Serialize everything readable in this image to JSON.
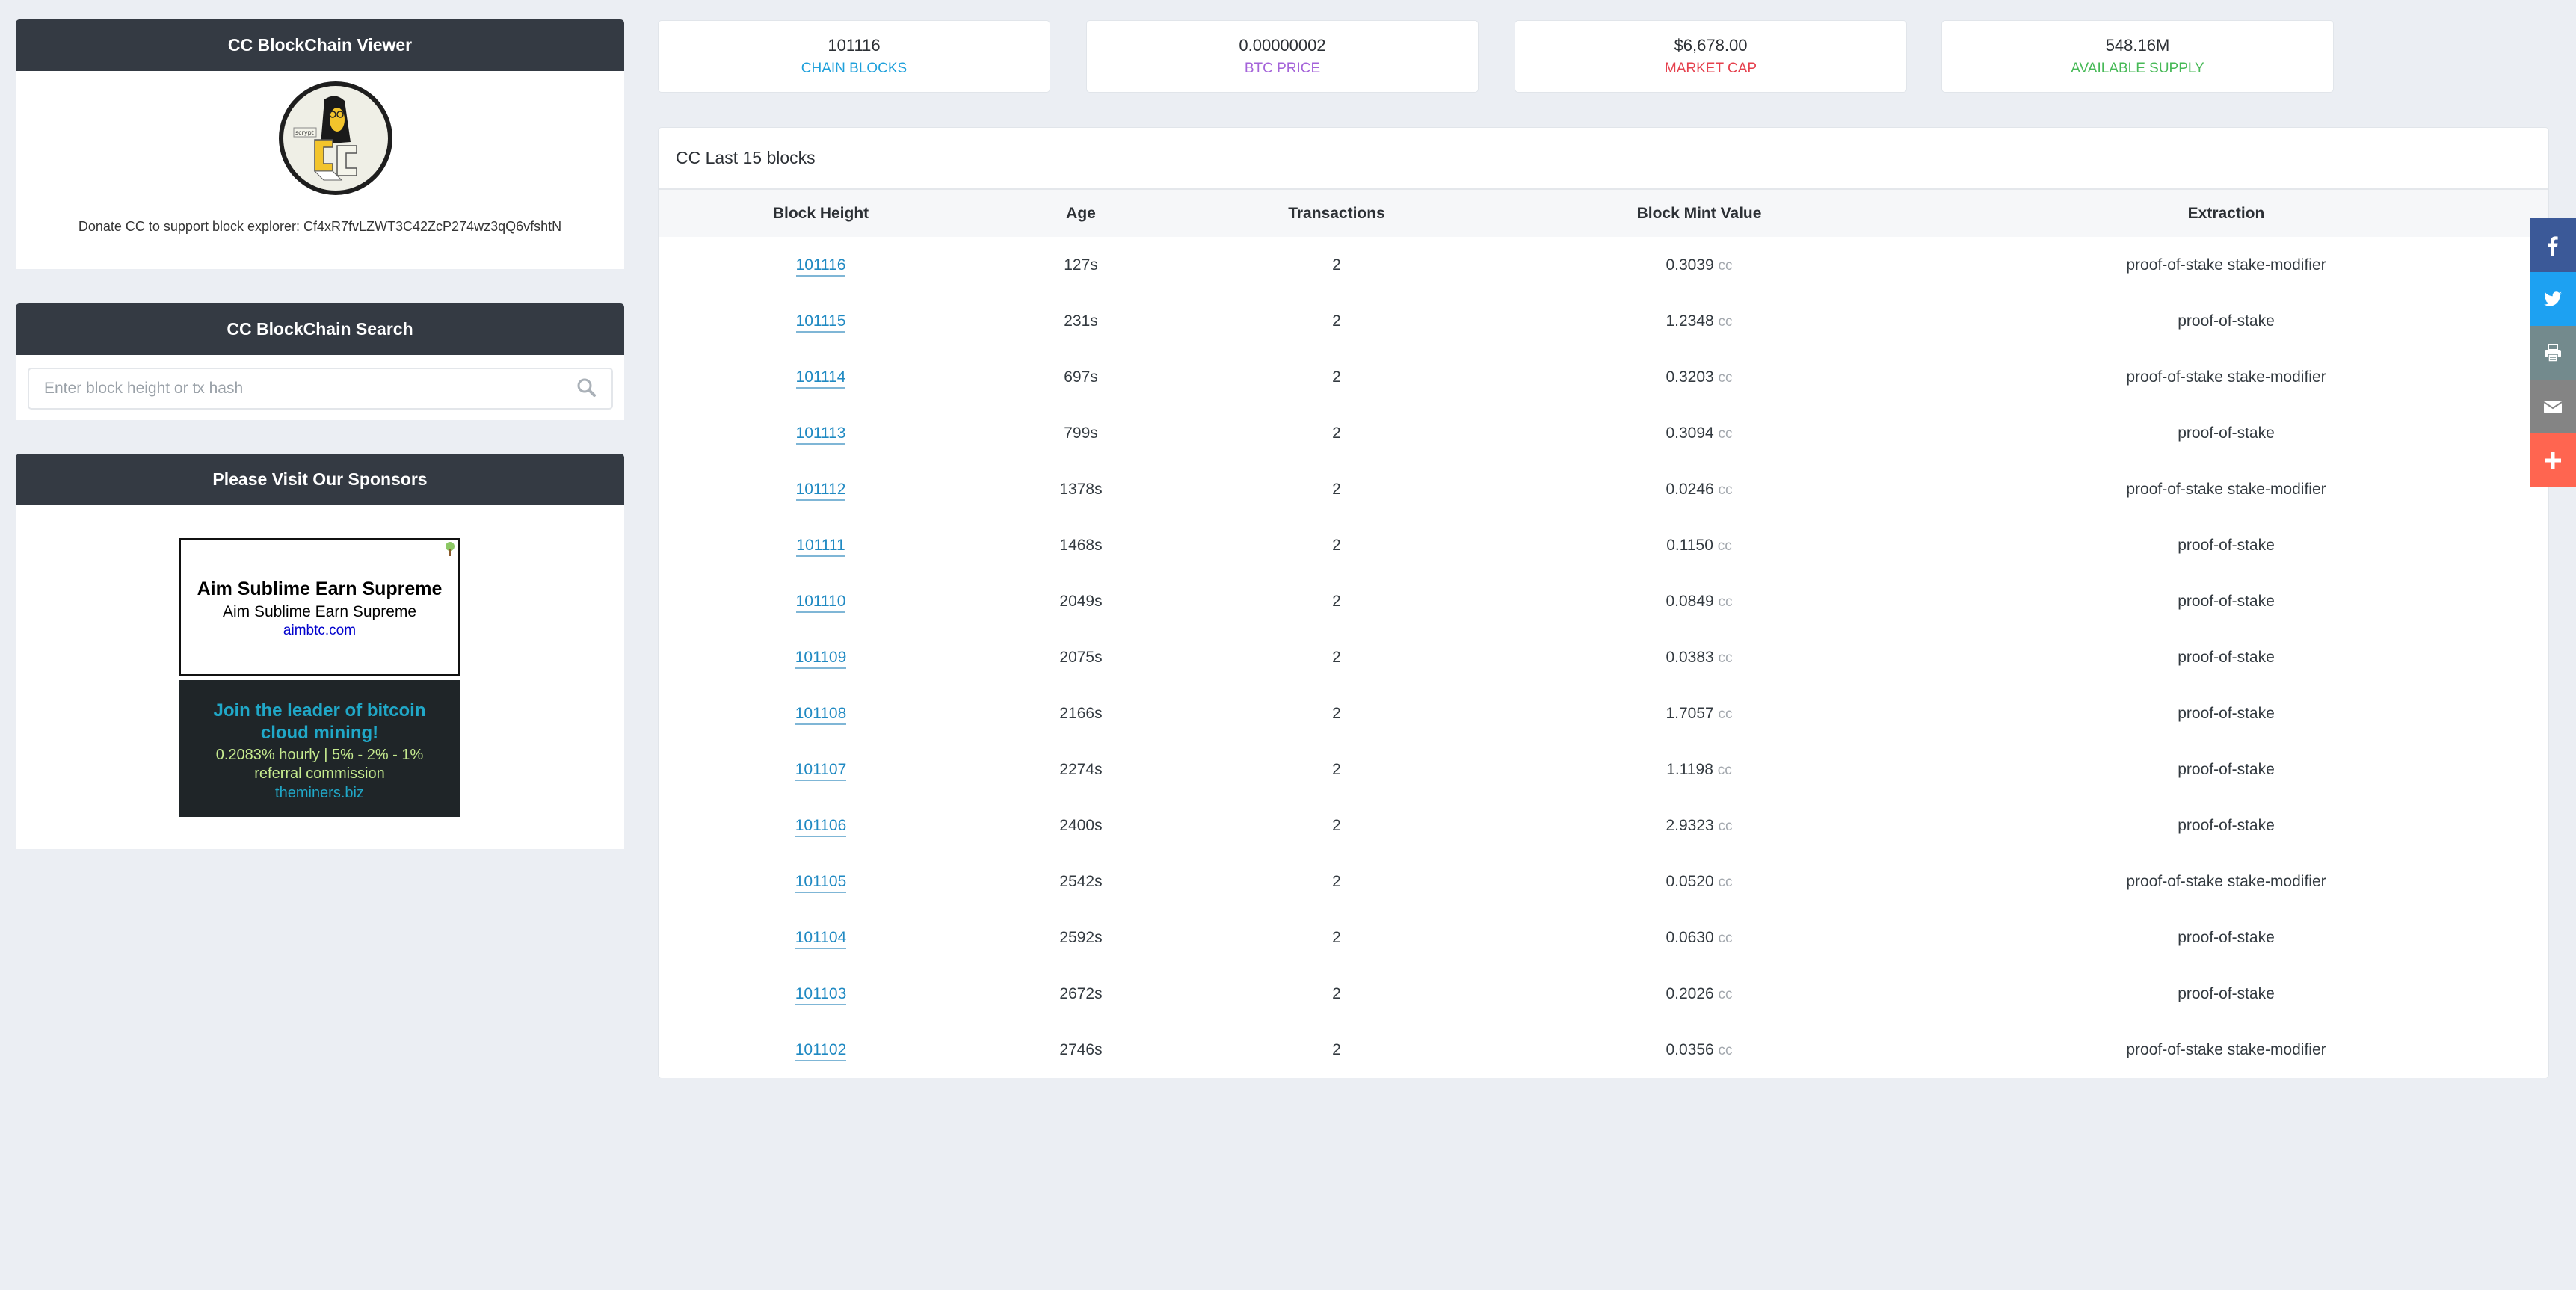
{
  "sidebar": {
    "viewer": {
      "title": "CC BlockChain Viewer",
      "logo_text": "scrypt",
      "donate_text": "Donate CC to support block explorer: Cf4xR7fvLZWT3C42ZcP274wz3qQ6vfshtN"
    },
    "search": {
      "title": "CC BlockChain Search",
      "placeholder": "Enter block height or tx hash",
      "value": "",
      "icon": "search-icon"
    },
    "sponsors": {
      "title": "Please Visit Our Sponsors",
      "ads": [
        {
          "headline": "Aim Sublime Earn Supreme",
          "subline": "Aim Sublime Earn Supreme",
          "url": "aimbtc.com"
        },
        {
          "headline": "Join the leader of bitcoin cloud mining!",
          "subline": "0.2083% hourly | 5% - 2% - 1% referral commission",
          "url": "theminers.biz"
        }
      ]
    }
  },
  "stats": [
    {
      "value": "101116",
      "label": "CHAIN BLOCKS",
      "color": "#1ea0db"
    },
    {
      "value": "0.00000002",
      "label": "BTC PRICE",
      "color": "#a463d9"
    },
    {
      "value": "$6,678.00",
      "label": "MARKET CAP",
      "color": "#e5404d"
    },
    {
      "value": "548.16M",
      "label": "AVAILABLE SUPPLY",
      "color": "#47b957"
    }
  ],
  "blocks": {
    "title": "CC Last 15 blocks",
    "columns": [
      "Block Height",
      "Age",
      "Transactions",
      "Block Mint Value",
      "Extraction"
    ],
    "unit": "cc",
    "rows": [
      {
        "height": "101116",
        "age": "127s",
        "tx": "2",
        "mint": "0.3039",
        "extraction": "proof-of-stake stake-modifier"
      },
      {
        "height": "101115",
        "age": "231s",
        "tx": "2",
        "mint": "1.2348",
        "extraction": "proof-of-stake"
      },
      {
        "height": "101114",
        "age": "697s",
        "tx": "2",
        "mint": "0.3203",
        "extraction": "proof-of-stake stake-modifier"
      },
      {
        "height": "101113",
        "age": "799s",
        "tx": "2",
        "mint": "0.3094",
        "extraction": "proof-of-stake"
      },
      {
        "height": "101112",
        "age": "1378s",
        "tx": "2",
        "mint": "0.0246",
        "extraction": "proof-of-stake stake-modifier"
      },
      {
        "height": "101111",
        "age": "1468s",
        "tx": "2",
        "mint": "0.1150",
        "extraction": "proof-of-stake"
      },
      {
        "height": "101110",
        "age": "2049s",
        "tx": "2",
        "mint": "0.0849",
        "extraction": "proof-of-stake"
      },
      {
        "height": "101109",
        "age": "2075s",
        "tx": "2",
        "mint": "0.0383",
        "extraction": "proof-of-stake"
      },
      {
        "height": "101108",
        "age": "2166s",
        "tx": "2",
        "mint": "1.7057",
        "extraction": "proof-of-stake"
      },
      {
        "height": "101107",
        "age": "2274s",
        "tx": "2",
        "mint": "1.1198",
        "extraction": "proof-of-stake"
      },
      {
        "height": "101106",
        "age": "2400s",
        "tx": "2",
        "mint": "2.9323",
        "extraction": "proof-of-stake"
      },
      {
        "height": "101105",
        "age": "2542s",
        "tx": "2",
        "mint": "0.0520",
        "extraction": "proof-of-stake stake-modifier"
      },
      {
        "height": "101104",
        "age": "2592s",
        "tx": "2",
        "mint": "0.0630",
        "extraction": "proof-of-stake"
      },
      {
        "height": "101103",
        "age": "2672s",
        "tx": "2",
        "mint": "0.2026",
        "extraction": "proof-of-stake"
      },
      {
        "height": "101102",
        "age": "2746s",
        "tx": "2",
        "mint": "0.0356",
        "extraction": "proof-of-stake stake-modifier"
      }
    ]
  },
  "share": [
    {
      "name": "facebook",
      "icon": "facebook-icon",
      "color": "#3b5998"
    },
    {
      "name": "twitter",
      "icon": "twitter-icon",
      "color": "#1da1f2"
    },
    {
      "name": "print",
      "icon": "print-icon",
      "color": "#738a8d"
    },
    {
      "name": "email",
      "icon": "email-icon",
      "color": "#848484"
    },
    {
      "name": "more",
      "icon": "plus-icon",
      "color": "#ff6550"
    }
  ]
}
